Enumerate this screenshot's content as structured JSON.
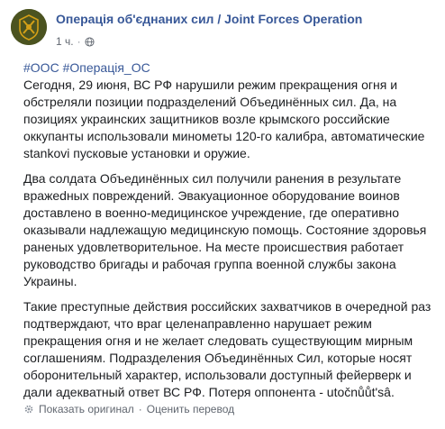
{
  "header": {
    "page_name": "Операція об'єднаних сил / Joint Forces Operation",
    "time": "1 ч.",
    "separator": "·",
    "visibility_icon": "globe-icon",
    "avatar_icon": "joint-forces-emblem"
  },
  "post": {
    "hashtags": [
      "#ООС",
      "#Операція_ОС"
    ],
    "paragraph1": "Сегодня, 29 июня, ВС РФ нарушили режим прекращения огня и обстреляли позиции подразделений Объединённых сил. Да, на позициях украинских защитников возле крымского российские оккупанты использовали минометы 120-го калибра, автоматические stankovi пусковые установки и оружие.",
    "paragraph2": "Два солдата Объединённых сил получили ранения в результате вражеdных повреждений. Эвакуационное оборудование воинов доставлено в военно-медицинское учреждение, где оперативно оказывали надлежащую медицинскую помощь. Состояние здоровья раненых удовлетворительное. На месте происшествия работает руководство бригады и рабочая группа военной службы закона Украины.",
    "paragraph3": "Такие преступные действия российских захватчиков в очередной раз подтверждают, что враг целенаправленно нарушает режим прекращения огня и не желает следовать существующим мирным соглашениям. Подразделения Объединённых Сил, которые носят оборонительный характер, использовали доступный фейерверк и дали адекватный ответ ВС РФ. Потеря оппонента - utočnůůt'sâ."
  },
  "footer": {
    "settings_icon": "gear-icon",
    "show_original": "Показать оригинал",
    "separator": "·",
    "rate_translation": "Оценить перевод"
  },
  "colors": {
    "link": "#385898",
    "text": "#1c1e21",
    "meta": "#616770",
    "avatar_bg": "#4b5320",
    "emblem": "#d4a017"
  }
}
